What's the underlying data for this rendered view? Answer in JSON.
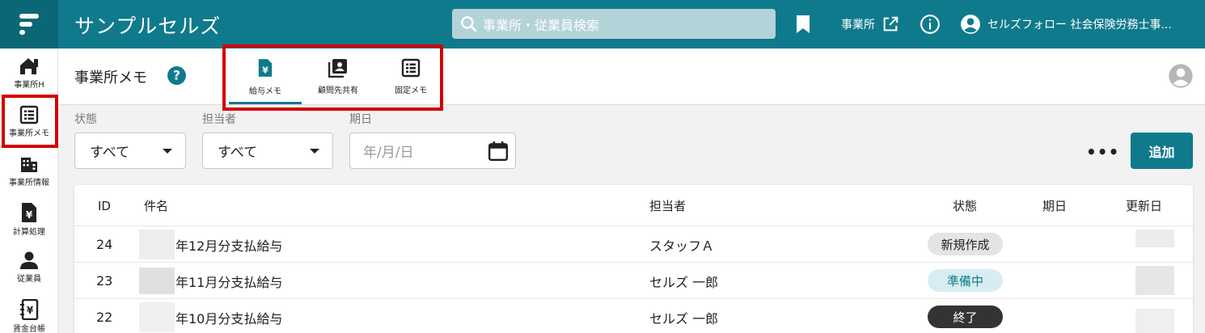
{
  "header": {
    "app_title": "サンプルセルズ",
    "search_placeholder": "事業所・従業員検索",
    "office_link_label": "事業所",
    "user_label": "セルズフォロー 社会保険労務士事..."
  },
  "sidebar": {
    "items": [
      {
        "label": "事業所H",
        "icon": "home-icon"
      },
      {
        "label": "事業所メモ",
        "icon": "memo-list-icon"
      },
      {
        "label": "事業所情報",
        "icon": "building-icon"
      },
      {
        "label": "計算処理",
        "icon": "yen-document-icon"
      },
      {
        "label": "従業員",
        "icon": "person-icon"
      },
      {
        "label": "賃金台帳",
        "icon": "ledger-icon"
      }
    ]
  },
  "page": {
    "title": "事業所メモ",
    "tabs": [
      {
        "label": "給与メモ",
        "icon": "yen-document-icon",
        "active": true
      },
      {
        "label": "顧問先共有",
        "icon": "contact-card-icon",
        "active": false
      },
      {
        "label": "固定メモ",
        "icon": "list-icon",
        "active": false
      }
    ]
  },
  "filters": {
    "status_label": "状態",
    "status_value": "すべて",
    "assignee_label": "担当者",
    "assignee_value": "すべて",
    "due_label": "期日",
    "due_placeholder": "年/月/日",
    "more_label": "•••",
    "add_label": "追加"
  },
  "table": {
    "headers": {
      "id": "ID",
      "name": "件名",
      "assignee": "担当者",
      "status": "状態",
      "due": "期日",
      "updated": "更新日"
    },
    "rows": [
      {
        "id": "24",
        "name": "年12月分支払給与",
        "assignee": "スタッフＡ",
        "status": "新規作成",
        "status_style": "new"
      },
      {
        "id": "23",
        "name": "年11月分支払給与",
        "assignee": "セルズ 一郎",
        "status": "準備中",
        "status_style": "prep"
      },
      {
        "id": "22",
        "name": "年10月分支払給与",
        "assignee": "セルズ 一郎",
        "status": "終了",
        "status_style": "done"
      }
    ]
  },
  "colors": {
    "brand": "#0f7a8c",
    "highlight": "#d40000",
    "badge_new": "#e4e4e4",
    "badge_prep": "#d8edf1",
    "badge_done": "#333333"
  }
}
